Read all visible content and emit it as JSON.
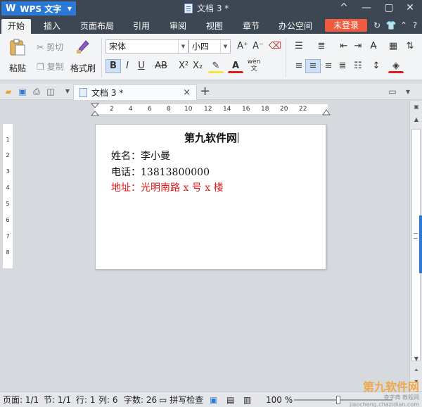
{
  "titlebar": {
    "app_name": "WPS 文字",
    "app_logo": "W",
    "document_title": "文档 3 *",
    "controls": [
      "^",
      "—",
      "▢",
      "✕"
    ]
  },
  "menu": {
    "tabs": [
      "开始",
      "插入",
      "页面布局",
      "引用",
      "审阅",
      "视图",
      "章节",
      "办公空间"
    ],
    "active_tab": "开始",
    "login_label": "未登录",
    "right_icons": [
      "refresh-icon",
      "shirt-icon",
      "chevron-up-icon",
      "help-icon"
    ]
  },
  "ribbon": {
    "paste_label": "粘贴",
    "cut_label": "剪切",
    "copy_label": "复制",
    "format_painter_label": "格式刷",
    "font_name": "宋体",
    "font_size": "小四",
    "bold": "B",
    "italic": "I",
    "underline": "U",
    "strikethrough": "AB",
    "superscript": "X²",
    "subscript": "X₂",
    "font_color_label": "A",
    "phonetic_label": "wén"
  },
  "doc_tabs": {
    "tab_label": "文档 3 *",
    "close": "×",
    "new_tab": "+"
  },
  "ruler": {
    "horizontal_ticks": [
      "2",
      "4",
      "6",
      "8",
      "10",
      "12",
      "14",
      "16",
      "18",
      "20",
      "22"
    ],
    "vertical_ticks": [
      "1",
      "2",
      "3",
      "4",
      "5",
      "6",
      "7",
      "8"
    ],
    "corner": "L"
  },
  "document": {
    "heading": "第九软件网",
    "name_line": "姓名：李小曼",
    "phone_line": "电话：13813800000",
    "address_line": "地址：光明南路 x 号 x 楼",
    "text_color": "#111111",
    "highlight_color": "#e01b1b"
  },
  "statusbar": {
    "page": "页面: 1/1",
    "section": "节: 1/1",
    "row": "行: 1",
    "col": "列: 6",
    "word_count": "字数: 26",
    "spellcheck": "拼写检查",
    "zoom": "100 %"
  },
  "watermark": {
    "text": "第九软件网",
    "sub": "查字典 教程网 jiaocheng.chazidian.com"
  },
  "colors": {
    "titlebar": "#3d4753",
    "accent": "#2b79d4",
    "login": "#f05b3f"
  }
}
